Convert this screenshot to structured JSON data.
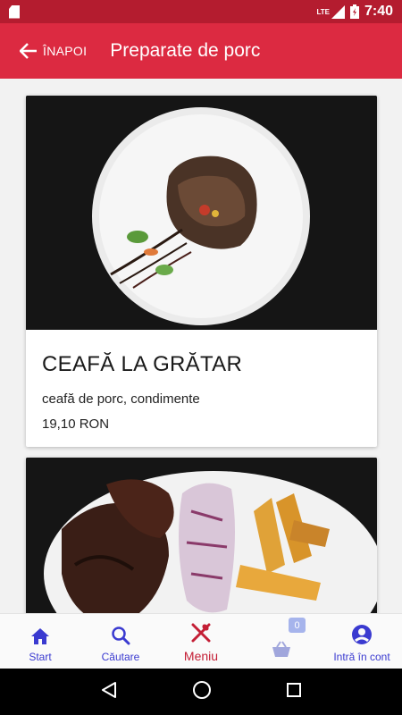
{
  "status_bar": {
    "time": "7:40",
    "network": "LTE"
  },
  "app_bar": {
    "back_label": "ÎNAPOI",
    "title": "Preparate de porc"
  },
  "products": [
    {
      "name": "CEAFĂ LA GRĂTAR",
      "description": "ceafă de porc, condimente",
      "price": "19,10 RON"
    }
  ],
  "bottom_nav": {
    "items": [
      {
        "label": "Start",
        "icon": "home-icon"
      },
      {
        "label": "Căutare",
        "icon": "search-icon"
      },
      {
        "label": "Meniu",
        "icon": "cutlery-icon"
      },
      {
        "label": "",
        "icon": "basket-icon",
        "badge": "0"
      },
      {
        "label": "Intră în cont",
        "icon": "account-icon"
      }
    ]
  },
  "colors": {
    "app_bar": "#dc2a41",
    "status_bar": "#b41c2f",
    "nav_active": "#c41e35",
    "nav_inactive": "#3a3ad0"
  }
}
